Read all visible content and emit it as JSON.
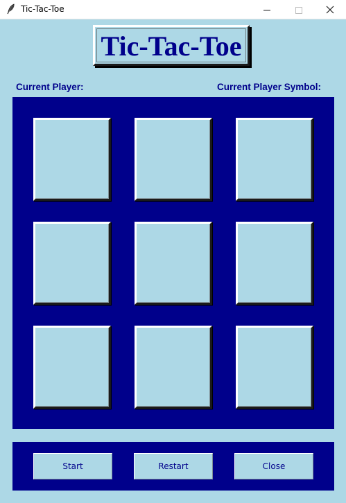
{
  "window": {
    "title": "Tic-Tac-Toe"
  },
  "header": {
    "title": "Tic-Tac-Toe"
  },
  "status": {
    "current_player_label": "Current Player:",
    "current_player_value": "",
    "current_symbol_label": "Current Player Symbol:",
    "current_symbol_value": ""
  },
  "board": {
    "cells": [
      "",
      "",
      "",
      "",
      "",
      "",
      "",
      "",
      ""
    ]
  },
  "controls": {
    "start_label": "Start",
    "restart_label": "Restart",
    "close_label": "Close"
  },
  "colors": {
    "background": "#add8e6",
    "panel": "#00008b",
    "text": "#00008b"
  },
  "icons": {
    "app": "feather-icon",
    "minimize": "minimize-icon",
    "maximize": "maximize-icon",
    "close": "close-icon"
  }
}
